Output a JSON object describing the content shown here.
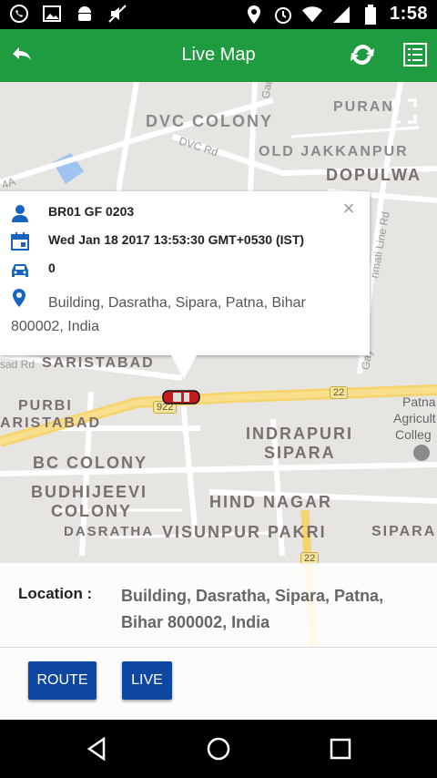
{
  "status_bar": {
    "time": "1:58",
    "left_icons": [
      "whatsapp-icon",
      "gallery-icon",
      "android-icon",
      "mute-icon"
    ],
    "right_icons": [
      "location-icon",
      "alarm-icon",
      "wifi-icon",
      "signal-icon",
      "battery-icon"
    ]
  },
  "app_bar": {
    "title": "Live Map",
    "back_icon": "back-arrow-icon",
    "refresh_icon": "refresh-icon",
    "list_icon": "list-icon",
    "color": "#1f9c3f"
  },
  "map": {
    "labels": {
      "dvc_colony": "DVC COLONY",
      "dvc_rd": "DVC Rd",
      "old_jakkanpur": "OLD JAKKANPUR",
      "dopulwa": "DOPULWA",
      "puran": "PURAN",
      "saristabad": "SARISTABAD",
      "purbi": "PURBI",
      "aristabad": "ARISTABAD",
      "indrapuri": "INDRAPURI",
      "sipara": "SIPARA",
      "bc_colony": "BC COLONY",
      "budhijeevi": "BUDHIJEEVI",
      "colony": "COLONY",
      "hind_nagar": "HIND NAGAR",
      "dasratha": "DASRATHA",
      "visunpur_pakri": "VISUNPUR PAKRI",
      "sipara_right": "SIPARA",
      "patna_agri_1": "Patna",
      "patna_agri_2": "Agricult",
      "patna_agri_3": "Colleg",
      "shield_922": "922",
      "shield_22": "22",
      "shield_22b": "22",
      "line_rd": "nmati Line Rd",
      "sad_rd": "sad Rd",
      "a4": "4A",
      "gayi": "Gay"
    }
  },
  "popup": {
    "vehicle": "BR01 GF 0203",
    "datetime": "Wed Jan 18 2017 13:53:30 GMT+0530 (IST)",
    "speed": "0",
    "address": "Building, Dasratha, Sipara, Patna, Bihar 800002, India",
    "icons": [
      "person-icon",
      "calendar-icon",
      "car-icon",
      "location-pin-icon"
    ]
  },
  "info_panel": {
    "location_label": "Location :",
    "location_value": "Building, Dasratha, Sipara, Patna, Bihar 800002, India",
    "route_button": "ROUTE",
    "live_button": "LIVE",
    "button_color": "#0d47a1"
  },
  "nav_bar": {
    "icons": [
      "back-triangle-icon",
      "home-circle-icon",
      "recents-square-icon"
    ]
  }
}
